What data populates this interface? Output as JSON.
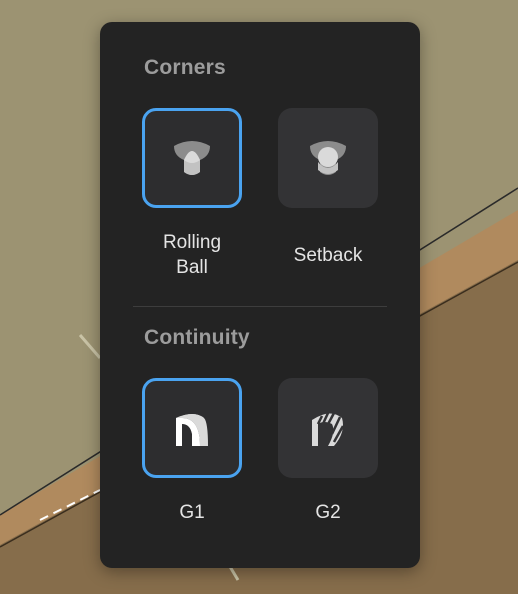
{
  "corners": {
    "title": "Corners",
    "options": [
      {
        "label": "Rolling\nBall",
        "icon": "rolling-ball-icon",
        "selected": true
      },
      {
        "label": "Setback",
        "icon": "setback-icon",
        "selected": false
      }
    ]
  },
  "continuity": {
    "title": "Continuity",
    "options": [
      {
        "label": "G1",
        "icon": "g1-continuity-icon",
        "selected": true
      },
      {
        "label": "G2",
        "icon": "g2-continuity-icon",
        "selected": false
      }
    ]
  },
  "colors": {
    "accent": "#4aa3f0",
    "panel": "#232323",
    "background_ground": "#9c9372",
    "background_brown": "#866d4b"
  }
}
